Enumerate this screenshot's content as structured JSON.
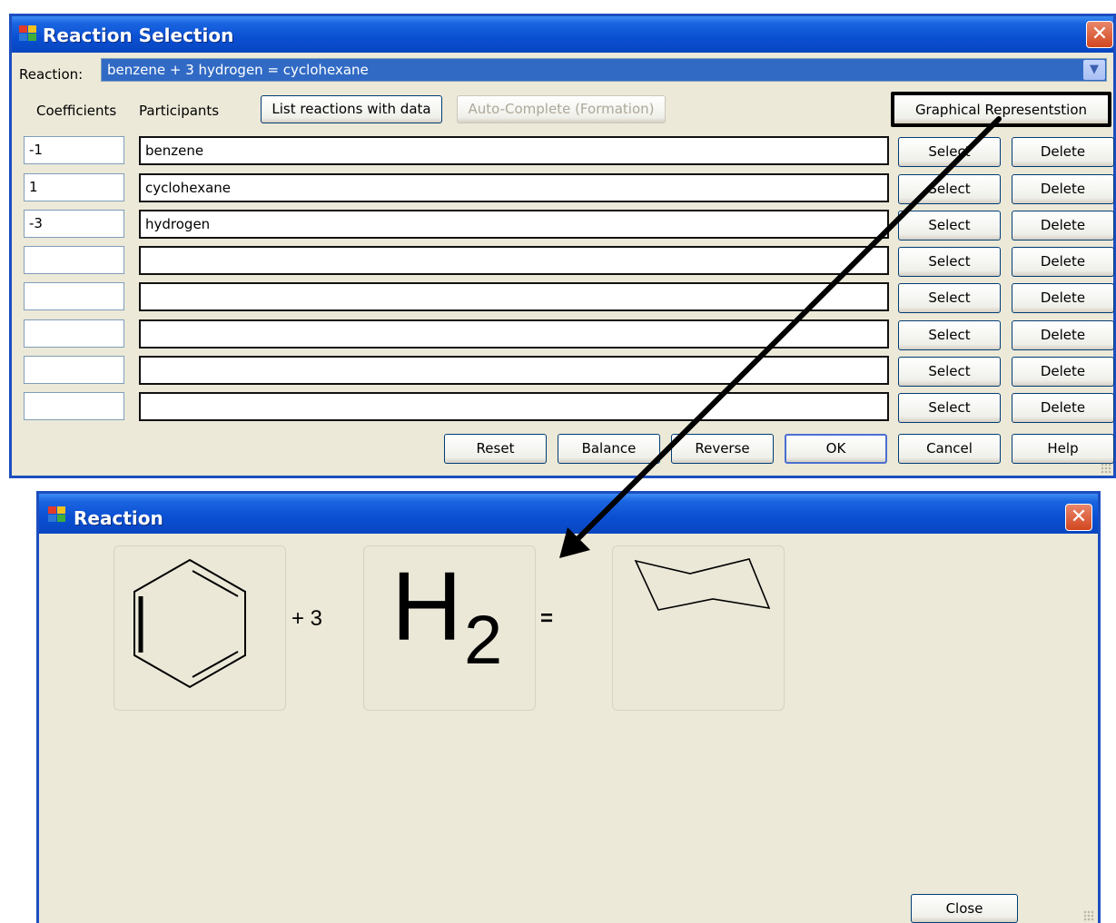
{
  "selection_dialog": {
    "title": "Reaction Selection",
    "reaction_label": "Reaction:",
    "reaction_value": "benzene + 3 hydrogen = cyclohexane",
    "coefficients_label": "Coefficients",
    "participants_label": "Participants",
    "list_reactions_button": "List reactions with data",
    "auto_complete_button": "Auto-Complete (Formation)",
    "graphical_button": "Graphical Representstion",
    "rows": [
      {
        "coefficient": "-1",
        "participant": "benzene",
        "select": "Select",
        "delete": "Delete"
      },
      {
        "coefficient": "1",
        "participant": "cyclohexane",
        "select": "Select",
        "delete": "Delete"
      },
      {
        "coefficient": "-3",
        "participant": "hydrogen",
        "select": "Select",
        "delete": "Delete"
      },
      {
        "coefficient": "",
        "participant": "",
        "select": "Select",
        "delete": "Delete"
      },
      {
        "coefficient": "",
        "participant": "",
        "select": "Select",
        "delete": "Delete"
      },
      {
        "coefficient": "",
        "participant": "",
        "select": "Select",
        "delete": "Delete"
      },
      {
        "coefficient": "",
        "participant": "",
        "select": "Select",
        "delete": "Delete"
      },
      {
        "coefficient": "",
        "participant": "",
        "select": "Select",
        "delete": "Delete"
      }
    ],
    "footer": {
      "reset": "Reset",
      "balance": "Balance",
      "reverse": "Reverse",
      "ok": "OK",
      "cancel": "Cancel",
      "help": "Help"
    }
  },
  "reaction_dialog": {
    "title": "Reaction",
    "plus_coefficient": "+ 3",
    "h2_symbol": "H",
    "h2_subscript": "2",
    "equals": "=",
    "close": "Close"
  },
  "colors": {
    "titlebar": "#0a4fd2",
    "window_bg": "#ece9d8",
    "selection_highlight": "#316ac5",
    "close_button": "#d2461f",
    "annotation": "#000000"
  },
  "icons": [
    "app-icon",
    "close-icon",
    "chevron-down-icon",
    "benzene-structure-icon",
    "cyclohexane-structure-icon",
    "annotation-arrow-icon"
  ]
}
